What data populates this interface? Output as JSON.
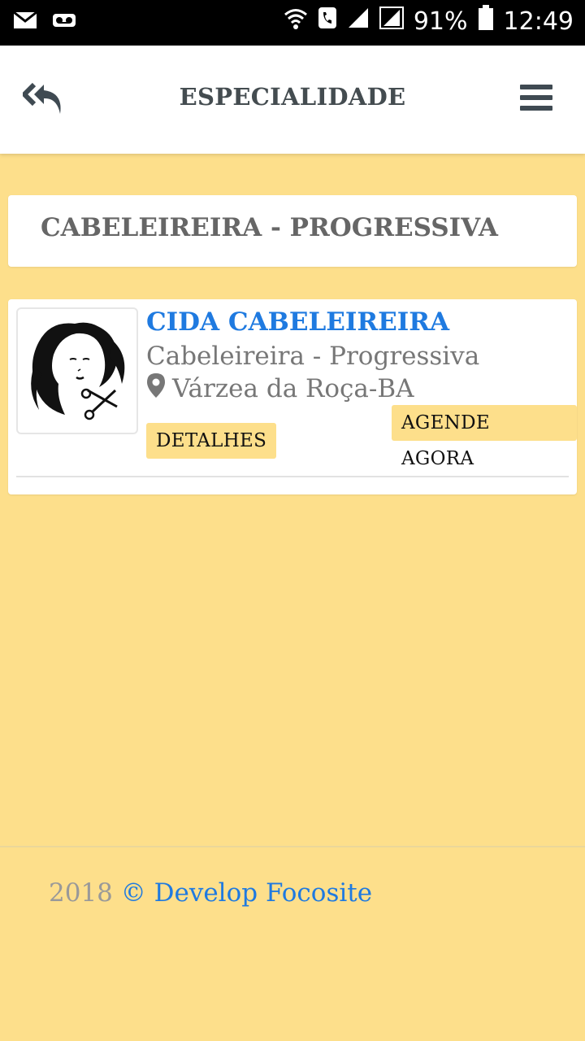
{
  "statusbar": {
    "battery": "91%",
    "time": "12:49",
    "icons": [
      "mail-icon",
      "voicemail-icon",
      "wifi-icon",
      "phone-icon",
      "signal-icon",
      "signal-2-icon",
      "battery-icon"
    ]
  },
  "appbar": {
    "title": "ESPECIALIDADE",
    "back_icon": "reply-all-icon",
    "menu_icon": "hamburger-menu-icon"
  },
  "category": {
    "title": "CABELEIREIRA - PROGRESSIVA"
  },
  "result": {
    "name": "CIDA CABELEIREIRA",
    "specialty": "Cabeleireira - Progressiva",
    "location": "Várzea da Roça-BA",
    "location_icon": "map-marker-icon",
    "image": "woman-hair-scissors-logo",
    "schedule_label": "AGENDE AGORA",
    "details_label": "DETALHES"
  },
  "footer": {
    "year": "2018",
    "credit": "© Develop Focosite"
  },
  "colors": {
    "background": "#fddf8b",
    "link": "#1f7ae0",
    "title": "#444c50",
    "muted": "#777777"
  }
}
